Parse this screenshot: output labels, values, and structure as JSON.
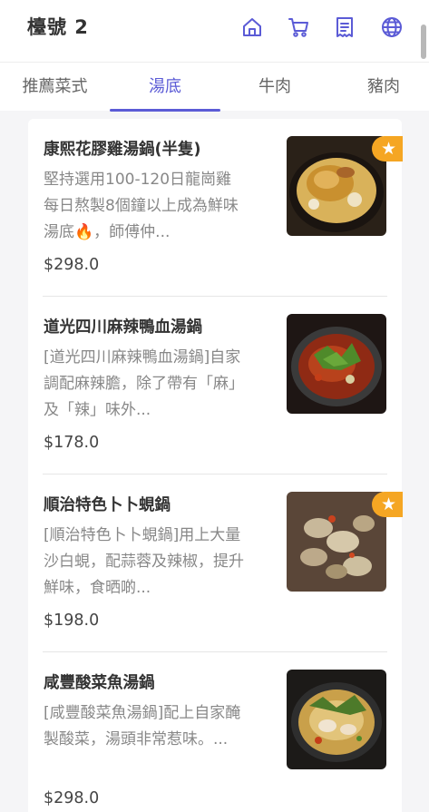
{
  "header": {
    "title": "檯號 2",
    "icons": [
      "home-icon",
      "cart-icon",
      "receipt-icon",
      "globe-icon"
    ],
    "accent": "#5b5bd6"
  },
  "tabs": [
    {
      "label": "推薦菜式",
      "active": false
    },
    {
      "label": "湯底",
      "active": true
    },
    {
      "label": "牛肉",
      "active": false
    },
    {
      "label": "豬肉",
      "active": false
    }
  ],
  "items": [
    {
      "name": "康熙花膠雞湯鍋(半隻)",
      "desc": "堅持選用100-120日龍崗雞每日熬製8個鐘以上成為鮮味湯底🔥，師傅仲...",
      "price": "$298.0",
      "featured": true
    },
    {
      "name": "道光四川麻辣鴨血湯鍋",
      "desc": "[道光四川麻辣鴨血湯鍋]自家調配麻辣膽，除了帶有「麻」及「辣」味外...",
      "price": "$178.0",
      "featured": false
    },
    {
      "name": "順治特色卜卜蜆鍋",
      "desc": "[順治特色卜卜蜆鍋]用上大量沙白蜆，配蒜蓉及辣椒，提升鮮味，食晒啲...",
      "price": "$198.0",
      "featured": true
    },
    {
      "name": "咸豐酸菜魚湯鍋",
      "desc": "[咸豐酸菜魚湯鍋]配上自家醃製酸菜，湯頭非常惹味。...",
      "price": "$298.0",
      "featured": false
    }
  ]
}
